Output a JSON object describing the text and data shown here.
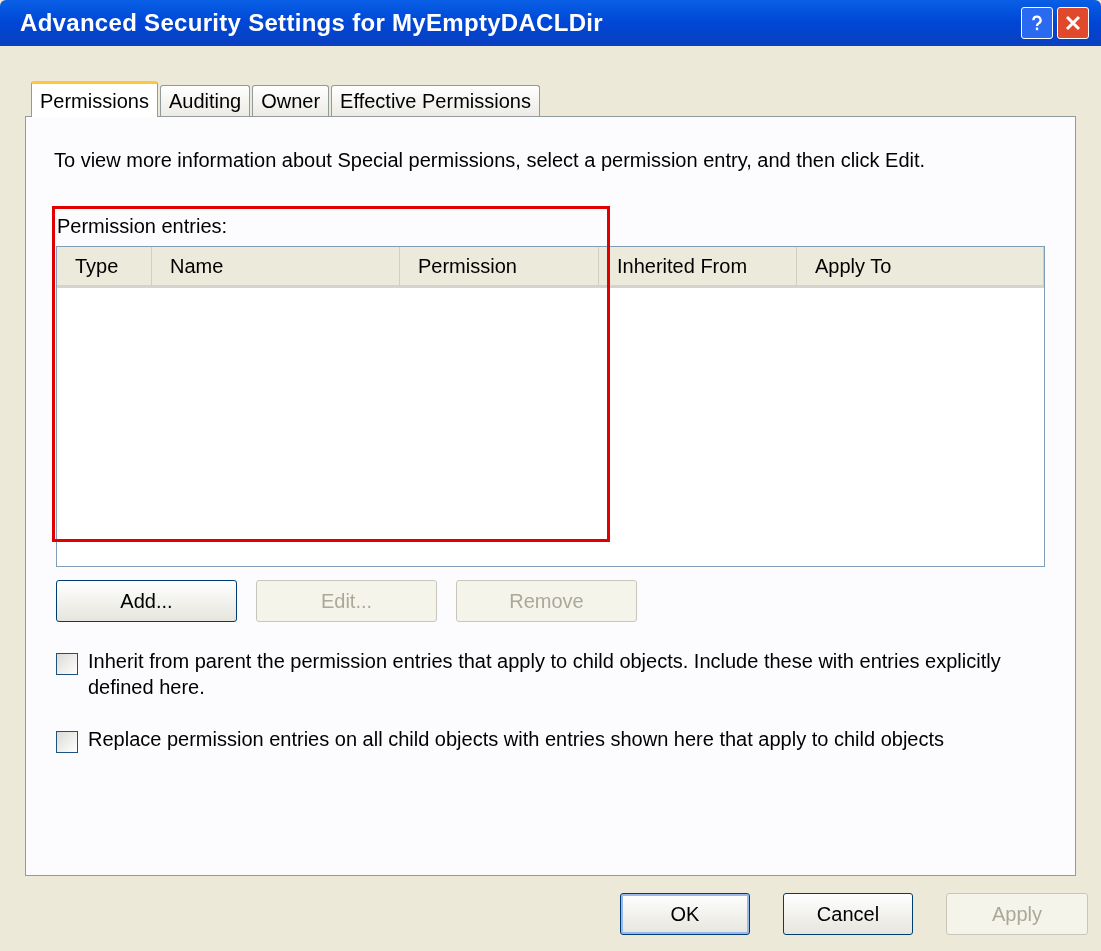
{
  "window": {
    "title": "Advanced Security Settings for MyEmptyDACLDir"
  },
  "tabs": [
    {
      "label": "Permissions",
      "selected": true
    },
    {
      "label": "Auditing",
      "selected": false
    },
    {
      "label": "Owner",
      "selected": false
    },
    {
      "label": "Effective Permissions",
      "selected": false
    }
  ],
  "info_text": "To view more information about Special permissions, select a permission entry, and then click Edit.",
  "entries_label": "Permission entries:",
  "table": {
    "columns": [
      "Type",
      "Name",
      "Permission",
      "Inherited From",
      "Apply To"
    ]
  },
  "entry_buttons": [
    {
      "label": "Add...",
      "disabled": false
    },
    {
      "label": "Edit...",
      "disabled": true
    },
    {
      "label": "Remove",
      "disabled": true
    }
  ],
  "checkboxes": [
    {
      "label": "Inherit from parent the permission entries that apply to child objects. Include these with entries explicitly defined here.",
      "checked": false
    },
    {
      "label": "Replace permission entries on all child objects with entries shown here that apply to child objects",
      "checked": false
    }
  ],
  "dialog_buttons": [
    {
      "label": "OK",
      "disabled": false,
      "default": true
    },
    {
      "label": "Cancel",
      "disabled": false,
      "default": false
    },
    {
      "label": "Apply",
      "disabled": true,
      "default": false
    }
  ]
}
